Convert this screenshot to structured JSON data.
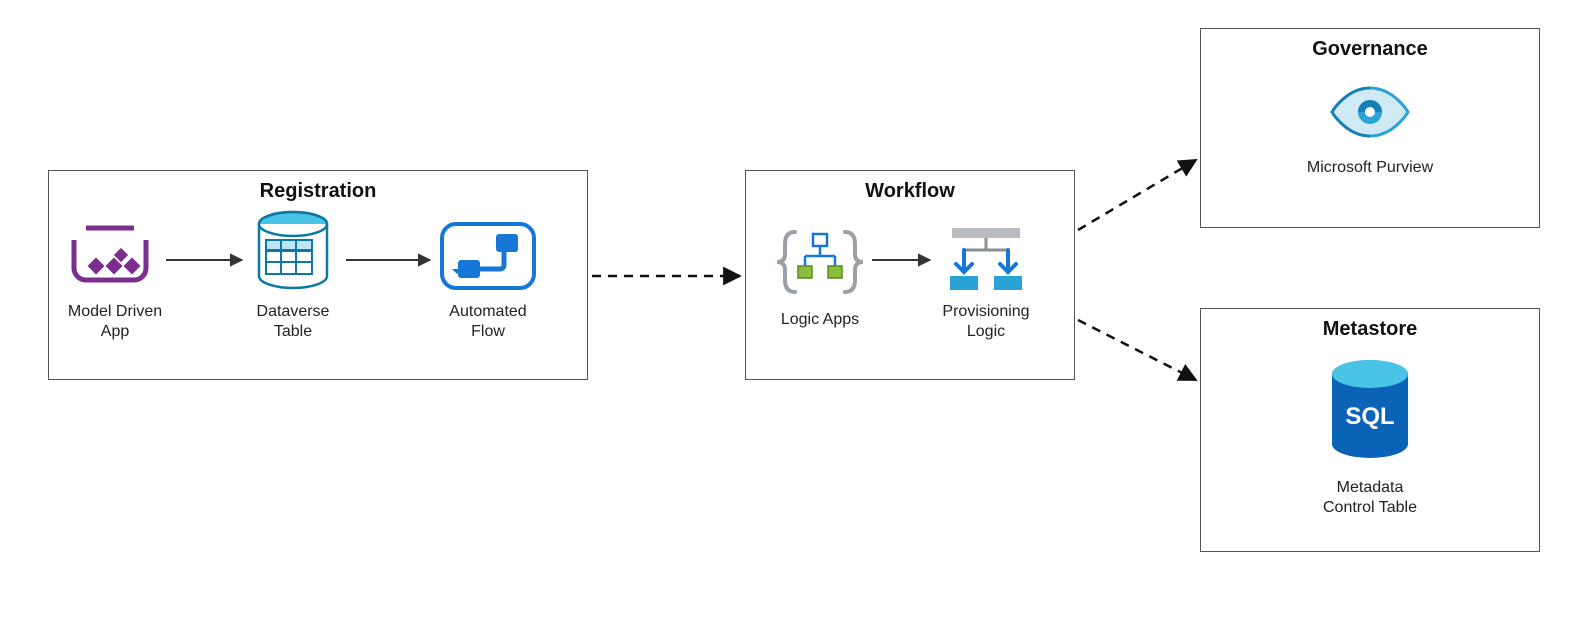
{
  "groups": {
    "registration": {
      "title": "Registration"
    },
    "workflow": {
      "title": "Workflow"
    },
    "governance": {
      "title": "Governance"
    },
    "metastore": {
      "title": "Metastore"
    }
  },
  "items": {
    "model_driven_app": {
      "label": "Model Driven\nApp"
    },
    "dataverse_table": {
      "label": "Dataverse\nTable"
    },
    "automated_flow": {
      "label": "Automated\nFlow"
    },
    "logic_apps": {
      "label": "Logic Apps"
    },
    "provisioning_logic": {
      "label": "Provisioning\nLogic"
    },
    "microsoft_purview": {
      "label": "Microsoft Purview"
    },
    "metadata_control_table": {
      "label": "Metadata\nControl Table"
    }
  }
}
